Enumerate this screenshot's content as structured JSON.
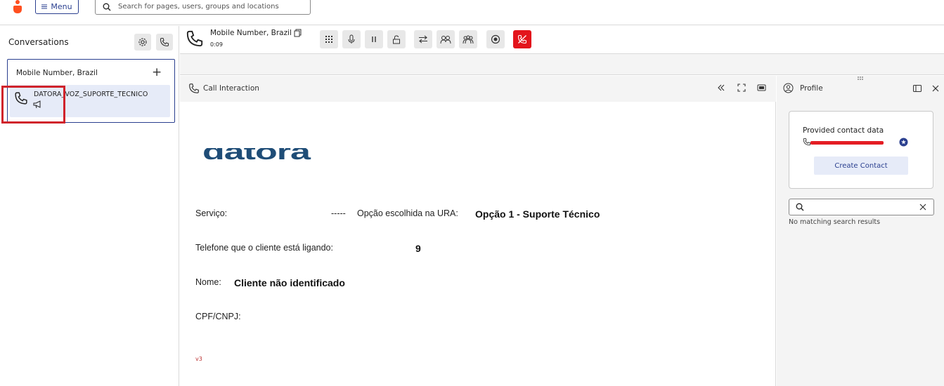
{
  "topbar": {
    "menu_label": "Menu",
    "search_placeholder": "Search for pages, users, groups and locations"
  },
  "conversations": {
    "title": "Conversations",
    "card_title": "Mobile Number, Brazil",
    "item_name": "DATORA_VOZ_SUPORTE_TECNICO"
  },
  "call": {
    "number": "Mobile Number, Brazil",
    "timer": "0:09"
  },
  "interaction": {
    "title": "Call Interaction",
    "brand": "datora",
    "servico_label": "Serviço:",
    "separator": "-----",
    "ura_label": "Opção escolhida na URA:",
    "ura_value": "Opção 1 - Suporte Técnico",
    "telefone_label": "Telefone que o cliente está ligando:",
    "telefone_value": "9",
    "nome_label": "Nome:",
    "nome_value": "Cliente não identificado",
    "cpf_label": "CPF/CNPJ:",
    "version": "v3"
  },
  "profile": {
    "title": "Profile",
    "contact_title": "Provided contact data",
    "create_label": "Create Contact",
    "no_results": "No matching search results"
  },
  "colors": {
    "accent": "#2a3f8f",
    "danger": "#e3141c",
    "brand": "#1f4d77",
    "highlight_box": "#d0232b"
  }
}
